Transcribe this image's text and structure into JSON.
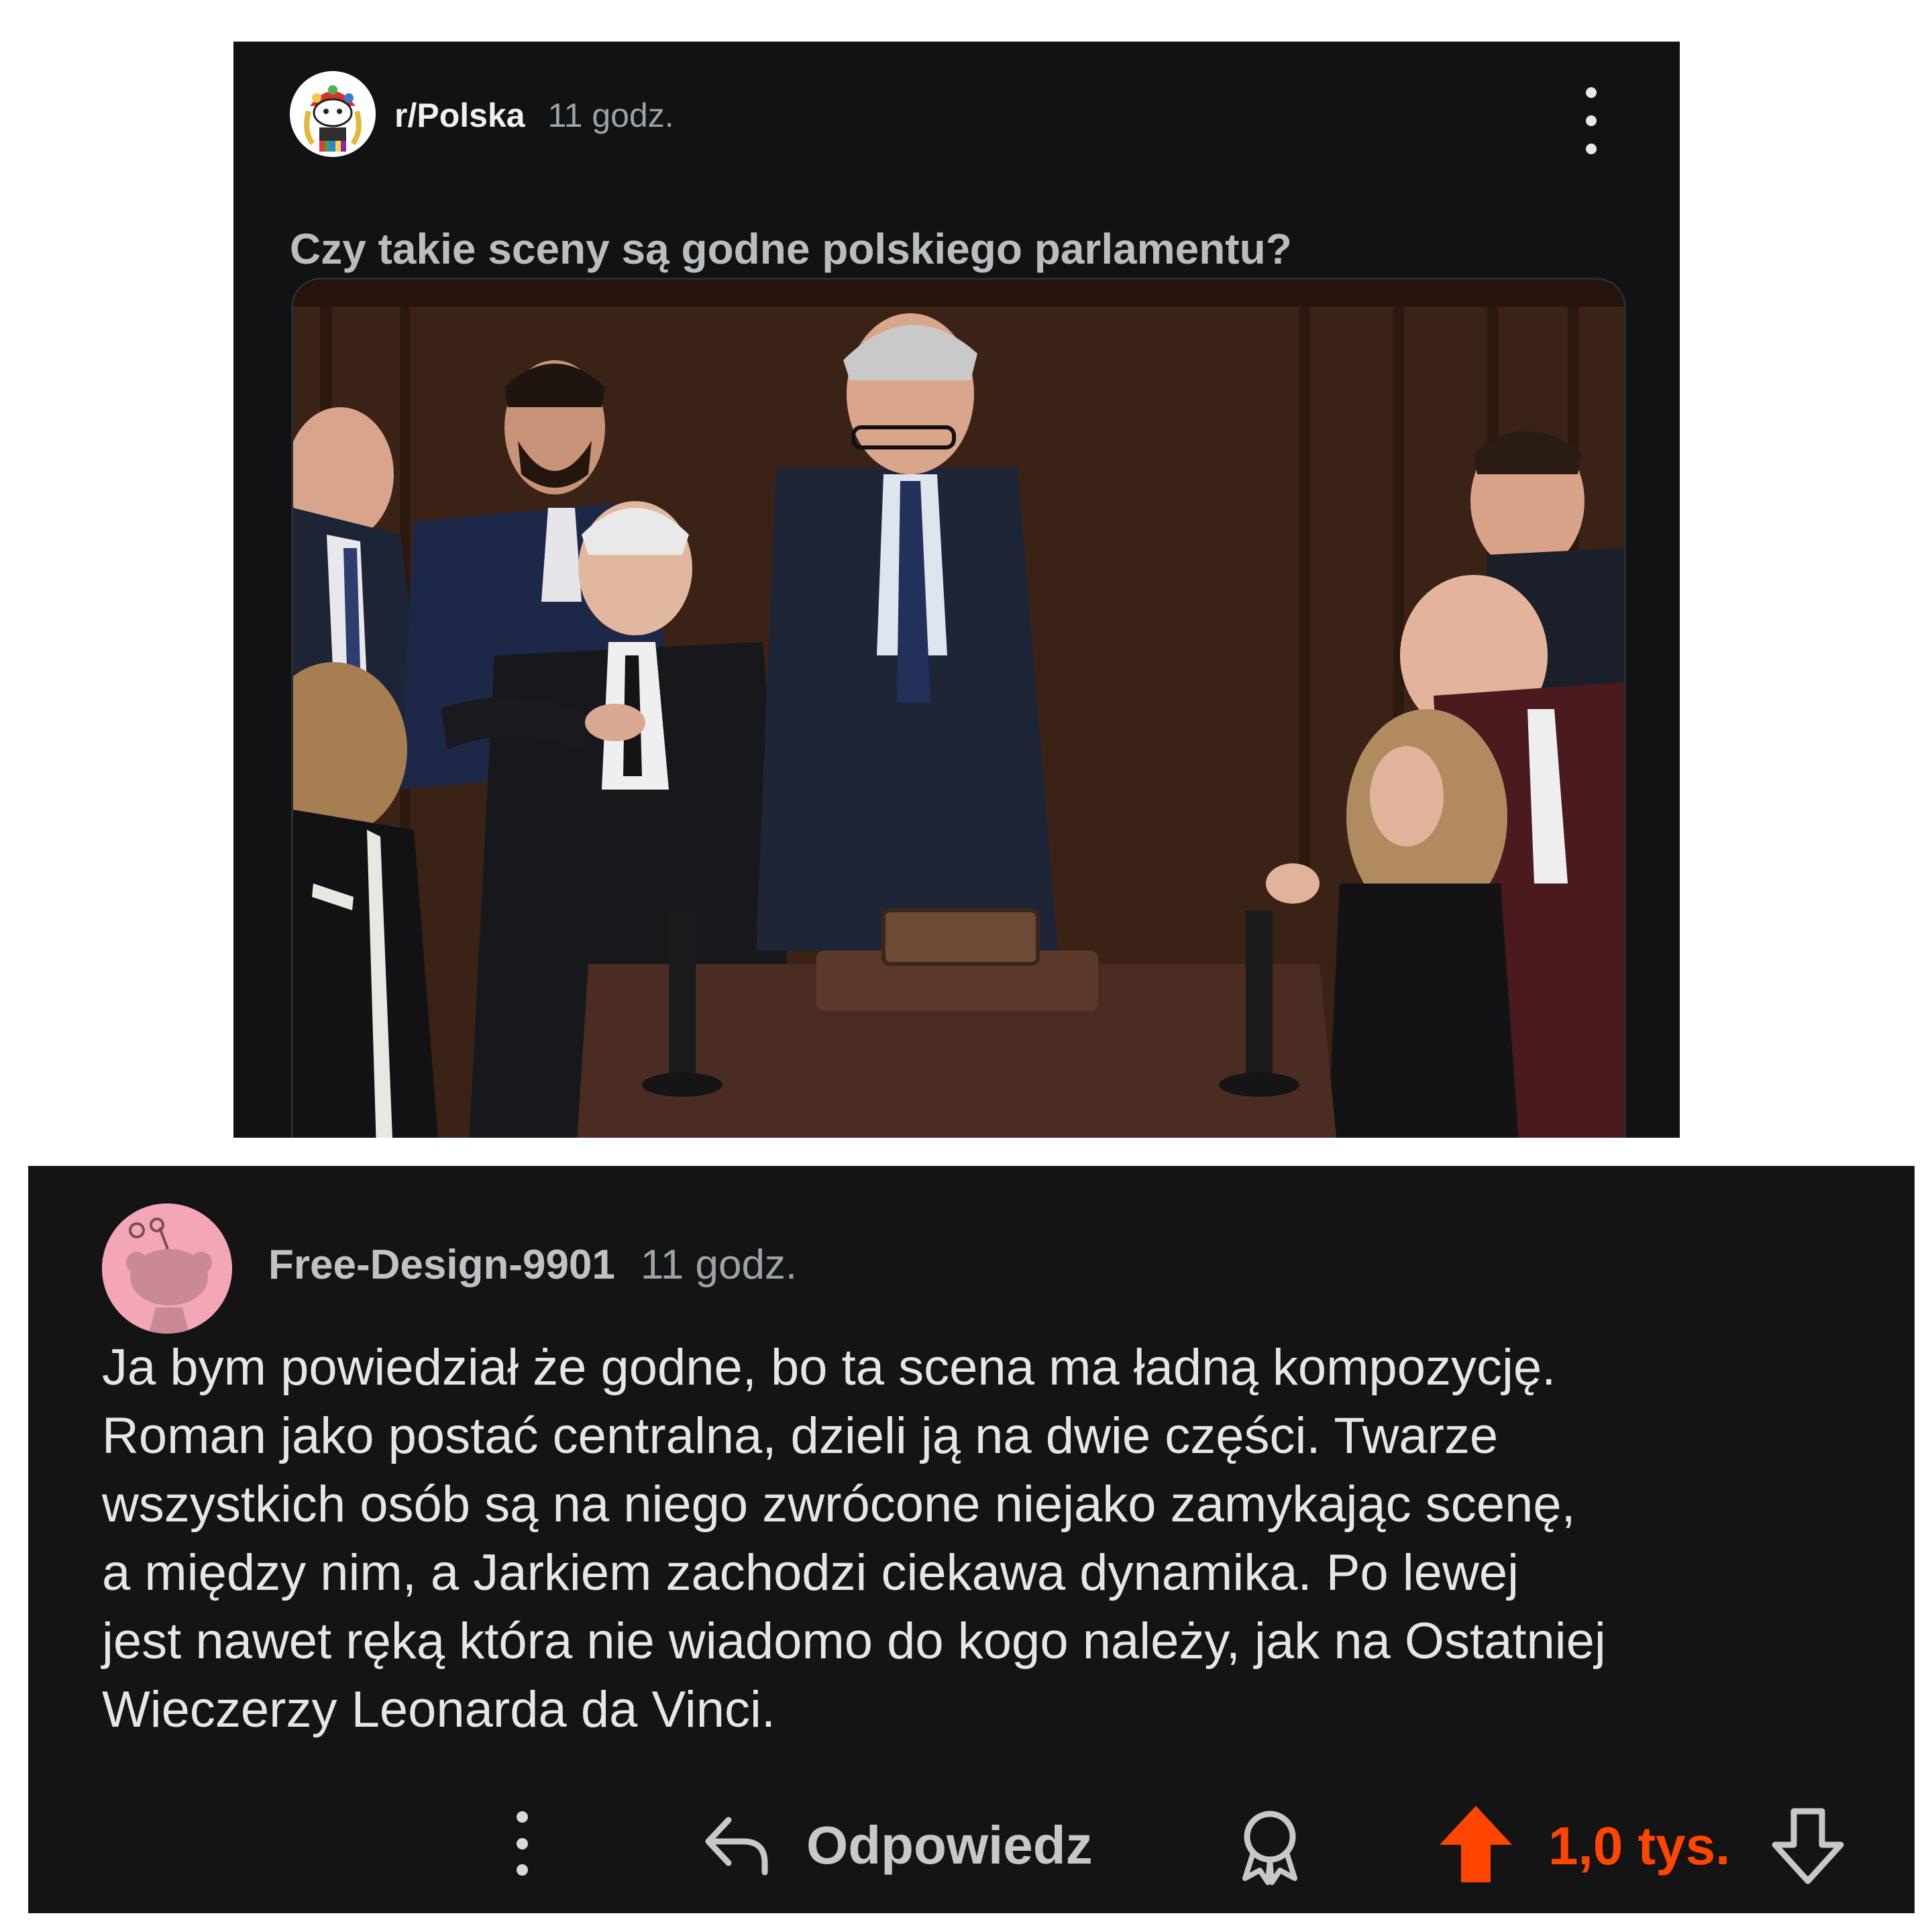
{
  "post": {
    "subreddit": "r/Polska",
    "time": "11 godz.",
    "title": "Czy takie sceny są godne polskiego parlamentu?",
    "more_icon": "kebab-vertical-icon",
    "image_description_icon": "photo"
  },
  "comment": {
    "username": "Free-Design-9901",
    "time": "11 godz.",
    "body_lines": [
      "Ja bym powiedział że godne, bo ta scena ma ładną kompozycję.",
      "Roman jako postać centralna, dzieli ją na dwie części. Twarze",
      "wszystkich osób są na niego zwrócone niejako zamykając scenę,",
      "a między nim, a Jarkiem zachodzi ciekawa dynamika. Po lewej",
      "jest nawet ręką która nie wiadomo do kogo należy, jak na Ostatniej",
      "Wieczerzy Leonarda da Vinci."
    ]
  },
  "actions": {
    "reply_label": "Odpowiedz",
    "vote_count": "1,0 tys.",
    "upvote_color": "#ff4500"
  }
}
